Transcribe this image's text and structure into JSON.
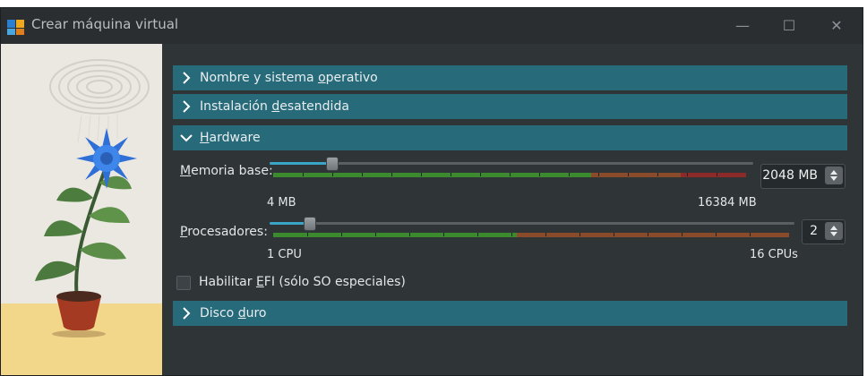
{
  "window": {
    "title": "Crear máquina virtual",
    "controls": {
      "minimize": "—",
      "maximize": "☐",
      "close": "✕"
    }
  },
  "sections": [
    {
      "pre": "Nombre y sistema ",
      "mnemonic": "o",
      "post": "perativo",
      "expanded": false
    },
    {
      "pre": "Instalación ",
      "mnemonic": "d",
      "post": "esatendida",
      "expanded": false
    },
    {
      "pre": "",
      "mnemonic": "H",
      "post": "ardware",
      "expanded": true
    },
    {
      "pre": "Disco ",
      "mnemonic": "d",
      "post": "uro",
      "expanded": false
    }
  ],
  "hardware": {
    "memory": {
      "label_mnemonic": "M",
      "label_rest": "emoria base:",
      "value": "2048 MB",
      "min_label": "4 MB",
      "max_label": "16384 MB",
      "slider_fraction": 0.125
    },
    "cpu": {
      "label_mnemonic": "P",
      "label_rest": "rocesadores:",
      "value": "2",
      "min_label": "1 CPU",
      "max_label": "16 CPUs",
      "slider_fraction": 0.067
    },
    "efi": {
      "pre": "Habilitar ",
      "mnemonic": "E",
      "post": "FI (sólo SO especiales)",
      "checked": false
    }
  },
  "colors": {
    "accent": "#276a7a",
    "ok": "#3b8a2e",
    "warn": "#8a4b2a",
    "bad": "#8c2a2a"
  }
}
